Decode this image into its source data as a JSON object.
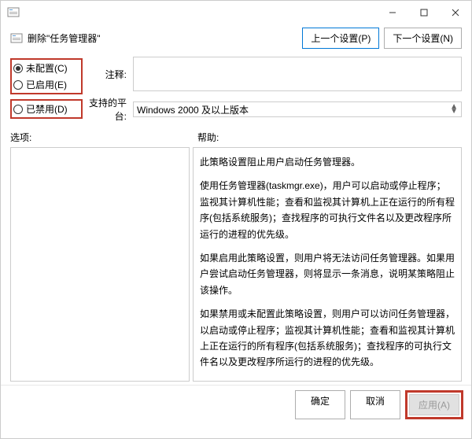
{
  "window_title": "删除\"任务管理器\"",
  "nav": {
    "prev": "上一个设置(P)",
    "next": "下一个设置(N)"
  },
  "radio": {
    "not_configured": "未配置(C)",
    "enabled": "已启用(E)",
    "disabled": "已禁用(D)"
  },
  "fields": {
    "comment_label": "注释:",
    "comment_value": "",
    "platform_label": "支持的平台:",
    "platform_value": "Windows 2000 及以上版本"
  },
  "sections": {
    "options_label": "选项:",
    "help_label": "帮助:"
  },
  "help_text": {
    "p1": "此策略设置阻止用户启动任务管理器。",
    "p2": "使用任务管理器(taskmgr.exe)，用户可以启动或停止程序；监视其计算机性能；查看和监视其计算机上正在运行的所有程序(包括系统服务)；查找程序的可执行文件名以及更改程序所运行的进程的优先级。",
    "p3": "如果启用此策略设置，则用户将无法访问任务管理器。如果用户尝试启动任务管理器，则将显示一条消息，说明某策略阻止该操作。",
    "p4": "如果禁用或未配置此策略设置，则用户可以访问任务管理器，以启动或停止程序；监视其计算机性能；查看和监视其计算机上正在运行的所有程序(包括系统服务)；查找程序的可执行文件名以及更改程序所运行的进程的优先级。"
  },
  "footer": {
    "ok": "确定",
    "cancel": "取消",
    "apply": "应用(A)"
  }
}
